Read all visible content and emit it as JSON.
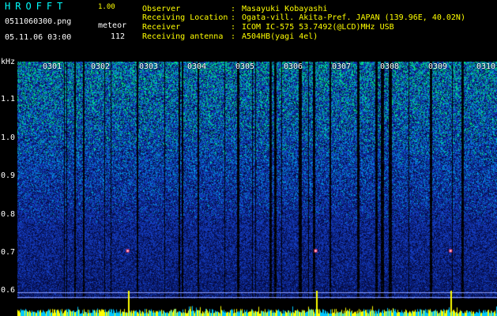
{
  "app": {
    "title": "HROFFT",
    "version": "1.00"
  },
  "file": {
    "name": "0511060300.png",
    "datetime": "05.11.06 03:00"
  },
  "counter": {
    "label": "meteor",
    "count": "112"
  },
  "station": [
    {
      "label": "Observer",
      "value": "Masayuki Kobayashi"
    },
    {
      "label": "Receiving Location",
      "value": "Ogata-vill. Akita-Pref. JAPAN (139.96E, 40.02N)"
    },
    {
      "label": "Receiver",
      "value": "ICOM IC-575 53.7492(@LCD)MHz USB"
    },
    {
      "label": "Receiving antenna",
      "value": "A504HB(yagi 4el)"
    }
  ],
  "colors": {
    "background": "#000000",
    "spectrum_low": "#102a8a",
    "spectrum_high": "#00ff60",
    "peak": "#ffff00",
    "text_accent": "#ffff00"
  },
  "chart_data": {
    "type": "heatmap",
    "y_unit_label": "kHz",
    "y_ticks": [
      "1.1",
      "1.0",
      "0.9",
      "0.8",
      "0.7",
      "0.6"
    ],
    "x_ticks": [
      "0301",
      "0302",
      "0303",
      "0304",
      "0305",
      "0306",
      "0307",
      "0308",
      "0309",
      "0310"
    ],
    "ylim": [
      0.58,
      1.2
    ],
    "detections": [
      {
        "time": "0302.6",
        "freq": 0.705
      },
      {
        "time": "0306.5",
        "freq": 0.705
      },
      {
        "time": "0309.3",
        "freq": 0.705
      }
    ]
  }
}
